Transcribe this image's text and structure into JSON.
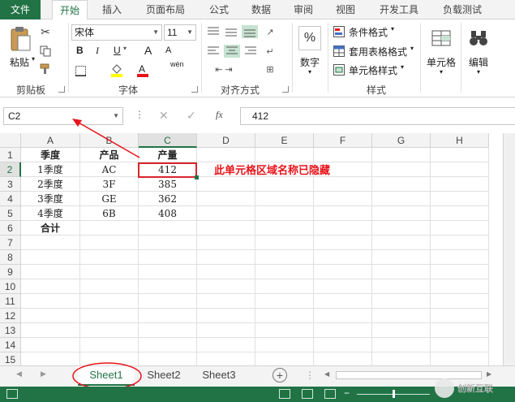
{
  "ribbon_tabs": [
    "文件",
    "开始",
    "插入",
    "页面布局",
    "公式",
    "数据",
    "审阅",
    "视图",
    "开发工具",
    "负载测试"
  ],
  "clipboard": {
    "paste": "粘贴",
    "group": "剪贴板"
  },
  "font": {
    "name": "宋体",
    "size": "11",
    "bold": "B",
    "italic": "I",
    "underline": "U",
    "grow": "A",
    "shrink": "A",
    "color_a": "A",
    "phonetic": "wén",
    "group": "字体"
  },
  "alignment": {
    "group": "对齐方式"
  },
  "number": {
    "label": "数字",
    "icon_text": "%"
  },
  "styles": {
    "conditional": "条件格式",
    "table": "套用表格格式",
    "cell": "单元格样式",
    "group": "样式"
  },
  "cells": {
    "label": "单元格"
  },
  "editing": {
    "label": "编辑"
  },
  "name_box": "C2",
  "formula_value": "412",
  "fx": "fx",
  "columns": [
    "A",
    "B",
    "C",
    "D",
    "E",
    "F",
    "G",
    "H"
  ],
  "rows": [
    "1",
    "2",
    "3",
    "4",
    "5",
    "6",
    "7",
    "8",
    "9",
    "10",
    "11",
    "12",
    "13",
    "14",
    "15"
  ],
  "table": {
    "header": [
      "季度",
      "产品",
      "产量"
    ],
    "data": [
      [
        "1季度",
        "AC",
        "412"
      ],
      [
        "2季度",
        "3F",
        "385"
      ],
      [
        "3季度",
        "GE",
        "362"
      ],
      [
        "4季度",
        "6B",
        "408"
      ]
    ],
    "total": "合计"
  },
  "annotation": "此单元格区域名称已隐藏",
  "sheets": [
    "Sheet1",
    "Sheet2",
    "Sheet3"
  ],
  "watermark": "创新互联",
  "colors": {
    "accent": "#217346",
    "annotation": "#e8141b"
  }
}
